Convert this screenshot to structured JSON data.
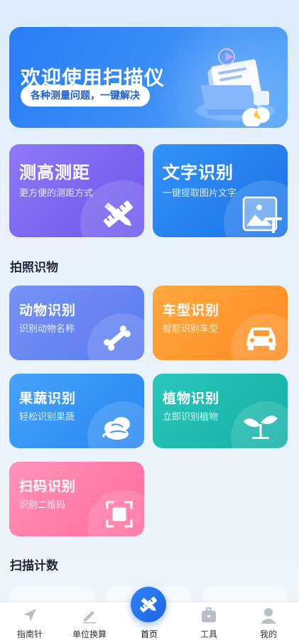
{
  "banner": {
    "title": "欢迎使用扫描仪",
    "subtitle": "各种测量问题，一键解决"
  },
  "features": [
    {
      "title": "测高测距",
      "subtitle": "更方便的测距方式",
      "icon": "ruler-pencil-icon",
      "color_from": "#8e72f5",
      "color_to": "#6b58ee"
    },
    {
      "title": "文字识别",
      "subtitle": "一键提取图片文字",
      "icon": "image-text-icon",
      "color_from": "#2d8cf6",
      "color_to": "#1a74e8"
    }
  ],
  "section_photo": "拍照识物",
  "recognize": [
    {
      "title": "动物识别",
      "subtitle": "识别动物名称",
      "icon": "bone-icon",
      "color_from": "#6c8cf4",
      "color_to": "#5a7cf0"
    },
    {
      "title": "车型识别",
      "subtitle": "智能识别车型",
      "icon": "car-icon",
      "color_from": "#ffa23a",
      "color_to": "#ff8c24"
    },
    {
      "title": "果蔬识别",
      "subtitle": "轻松识别果蔬",
      "icon": "vegetable-icon",
      "color_from": "#3d9cf8",
      "color_to": "#2a88f3"
    },
    {
      "title": "植物识别",
      "subtitle": "立即识别植物",
      "icon": "sprout-icon",
      "color_from": "#23c3b6",
      "color_to": "#17b0a8"
    },
    {
      "title": "扫码识别",
      "subtitle": "识别二维码",
      "icon": "scan-frame-icon",
      "color_from": "#ff8cb5",
      "color_to": "#ff6fa0"
    }
  ],
  "section_count": "扫描计数",
  "tabs": [
    {
      "label": "指南针",
      "icon": "compass-icon"
    },
    {
      "label": "单位换算",
      "icon": "pen-icon"
    },
    {
      "label": "首页",
      "icon": "home-ruler-icon"
    },
    {
      "label": "工具",
      "icon": "toolbox-icon"
    },
    {
      "label": "我的",
      "icon": "user-icon"
    }
  ],
  "colors": {
    "accent": "#2a7df6",
    "background": "#e7f1fb"
  }
}
